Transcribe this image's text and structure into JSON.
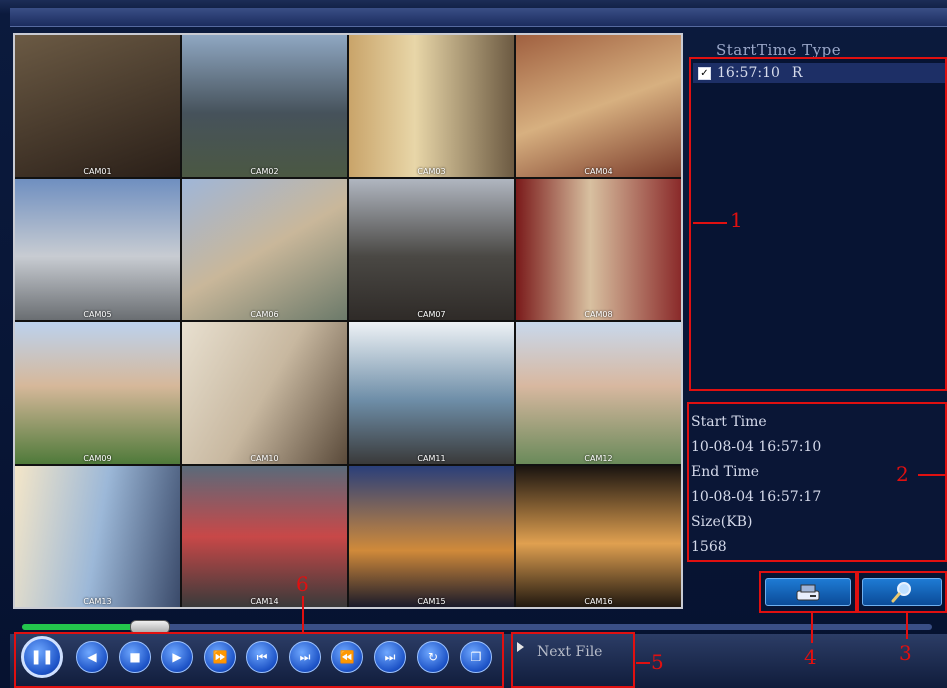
{
  "file_list": {
    "header": "StartTime Type",
    "rows": [
      {
        "time": "16:57:10",
        "type": "R",
        "checked": true
      }
    ]
  },
  "info": {
    "start_label": "Start Time",
    "start_value": "10-08-04 16:57:10",
    "end_label": "End Time",
    "end_value": "10-08-04 16:57:17",
    "size_label": "Size(KB)",
    "size_value": "1568"
  },
  "cameras": [
    "CAM01",
    "CAM02",
    "CAM03",
    "CAM04",
    "CAM05",
    "CAM06",
    "CAM07",
    "CAM08",
    "CAM09",
    "CAM10",
    "CAM11",
    "CAM12",
    "CAM13",
    "CAM14",
    "CAM15",
    "CAM16"
  ],
  "next_file_label": "Next File",
  "playback_progress": 0.14,
  "callouts": [
    "1",
    "2",
    "3",
    "4",
    "5",
    "6"
  ],
  "colors": {
    "annotation": "#e01010",
    "button": "#1c52c6"
  }
}
